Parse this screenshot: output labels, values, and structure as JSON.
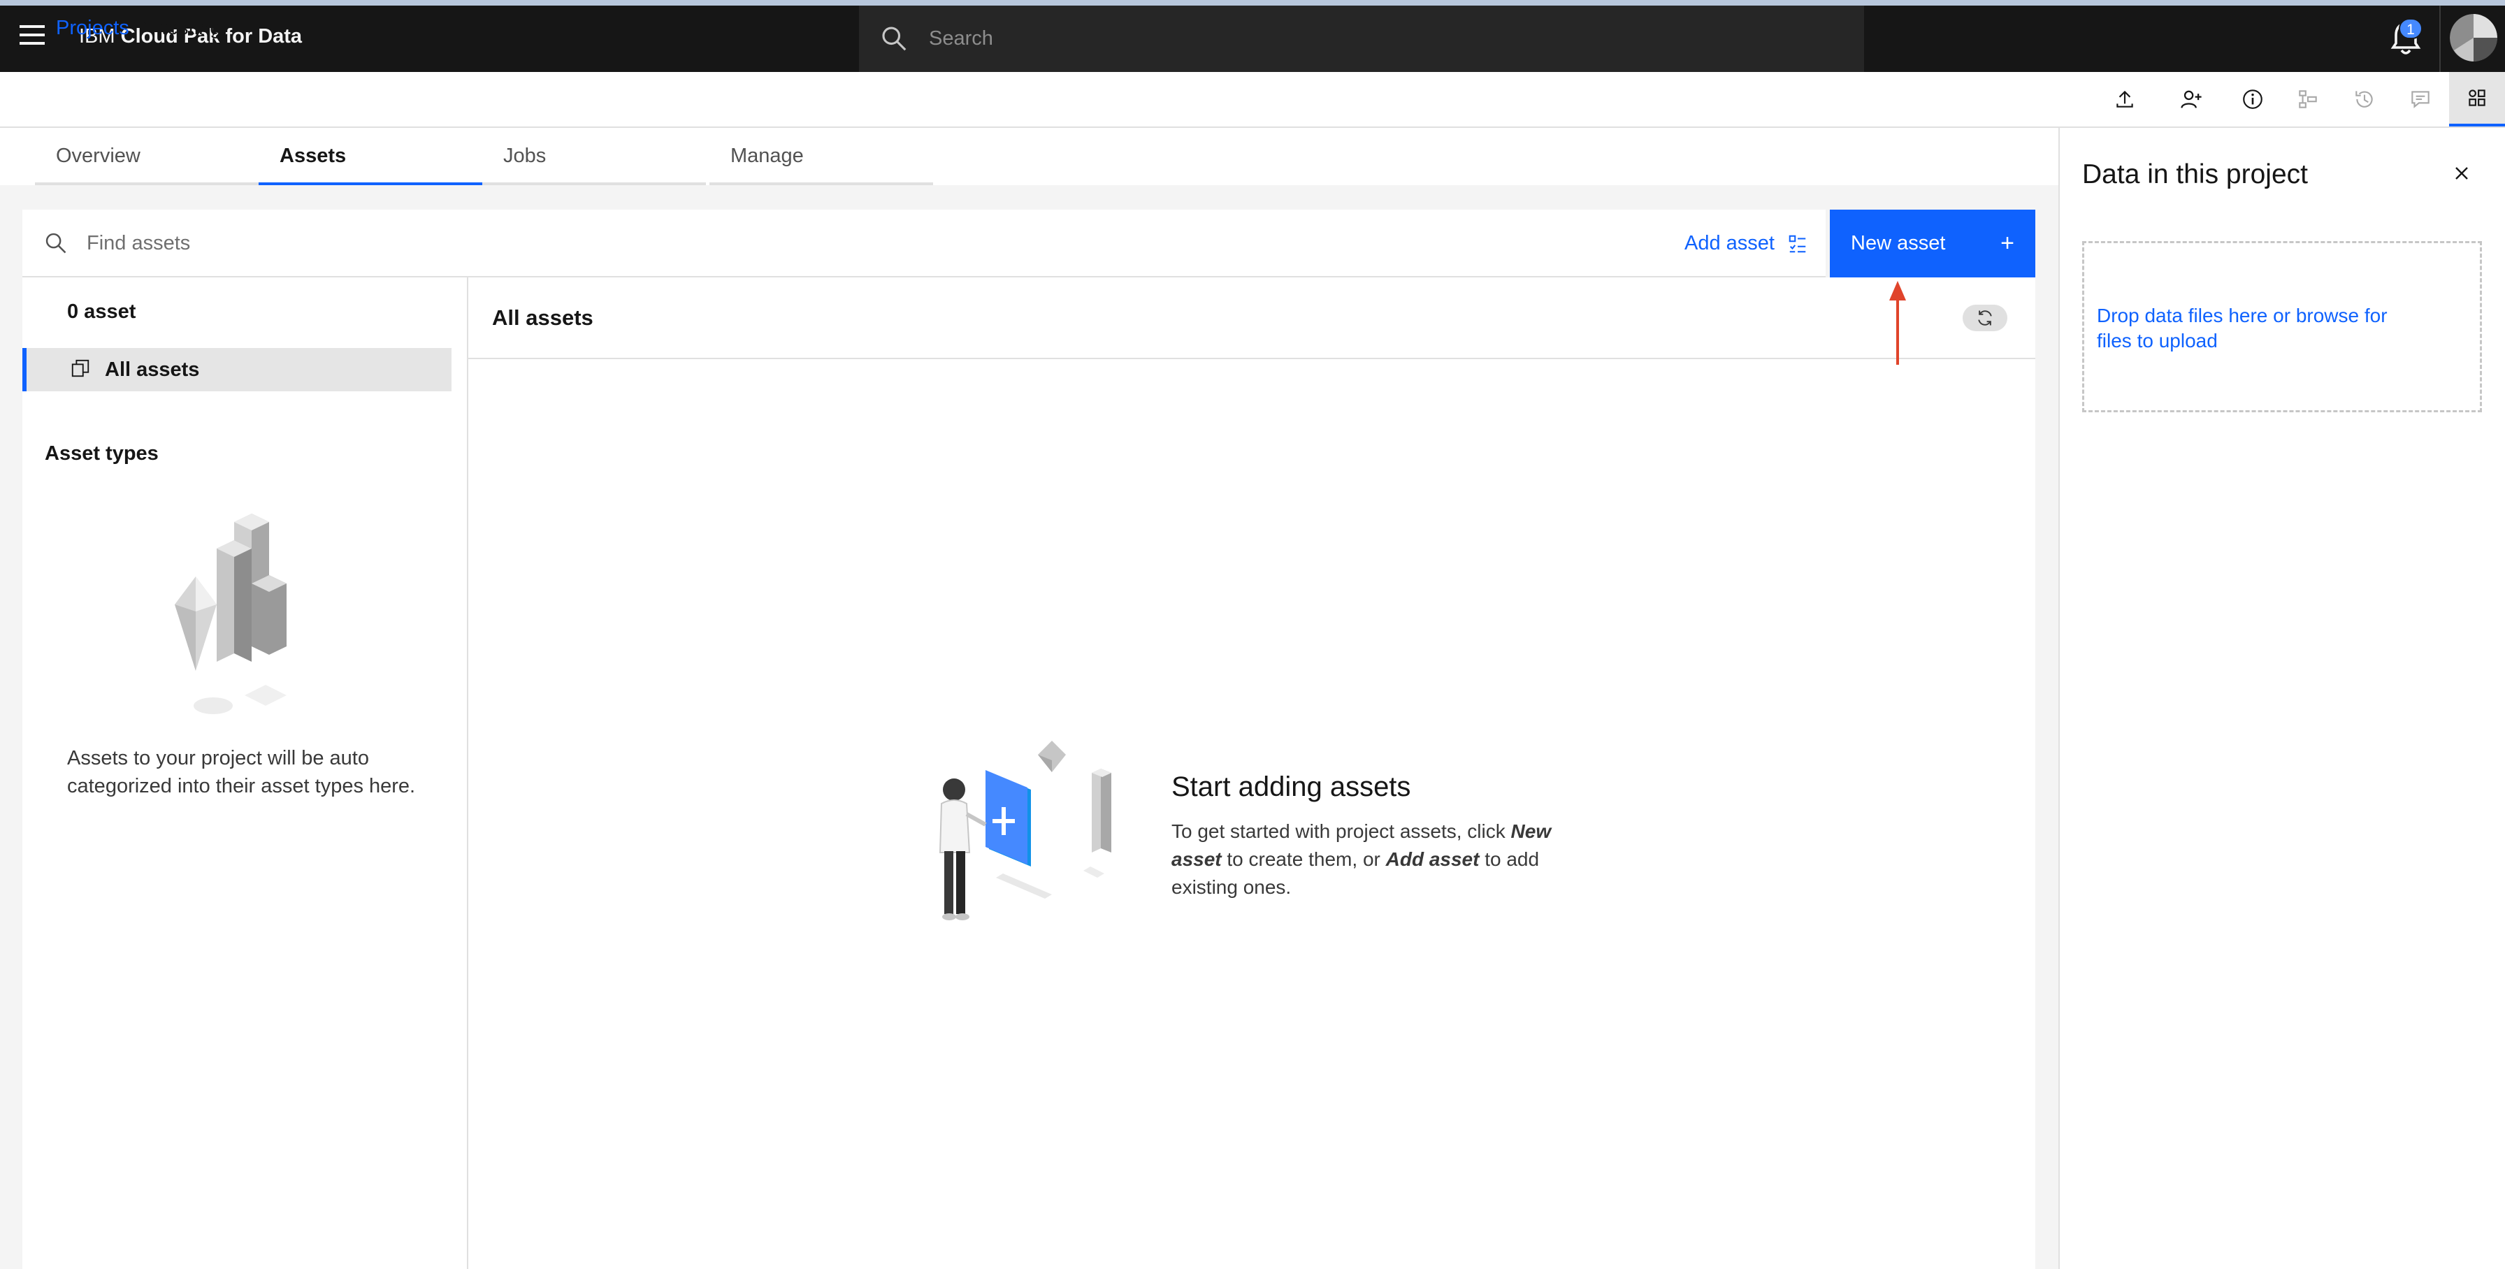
{
  "header": {
    "brand_prefix": "IBM",
    "brand_name": "Cloud Pak for Data",
    "search_placeholder": "Search",
    "notification_count": "1"
  },
  "breadcrumb": {
    "root": "Projects",
    "separator": "/",
    "current": "testing"
  },
  "toolbar_icons": [
    "upload-icon",
    "add-collaborator-icon",
    "info-icon",
    "flow-icon",
    "history-icon",
    "comment-icon",
    "data-panel-icon"
  ],
  "tabs": [
    {
      "label": "Overview",
      "active": false
    },
    {
      "label": "Assets",
      "active": true
    },
    {
      "label": "Jobs",
      "active": false
    },
    {
      "label": "Manage",
      "active": false
    }
  ],
  "find": {
    "placeholder": "Find assets",
    "add_asset_label": "Add asset",
    "new_asset_label": "New asset",
    "new_asset_icon": "+"
  },
  "left_panel": {
    "count": "0 asset",
    "all_assets_label": "All assets",
    "asset_types_heading": "Asset types",
    "asset_types_text": "Assets to your project will be auto categorized into their asset types here."
  },
  "main": {
    "title": "All assets",
    "empty_title": "Start adding assets",
    "empty_desc_1": "To get started with project assets, click ",
    "empty_desc_new": "New asset",
    "empty_desc_2": " to create them, or ",
    "empty_desc_add": "Add asset",
    "empty_desc_3": " to add existing ones."
  },
  "side_panel": {
    "title": "Data in this project",
    "close_icon": "×",
    "drop_text": "Drop data files here or browse for files to upload"
  },
  "colors": {
    "primary": "#0f62fe",
    "header_bg": "#161616",
    "annotation_arrow": "#e0442b"
  }
}
